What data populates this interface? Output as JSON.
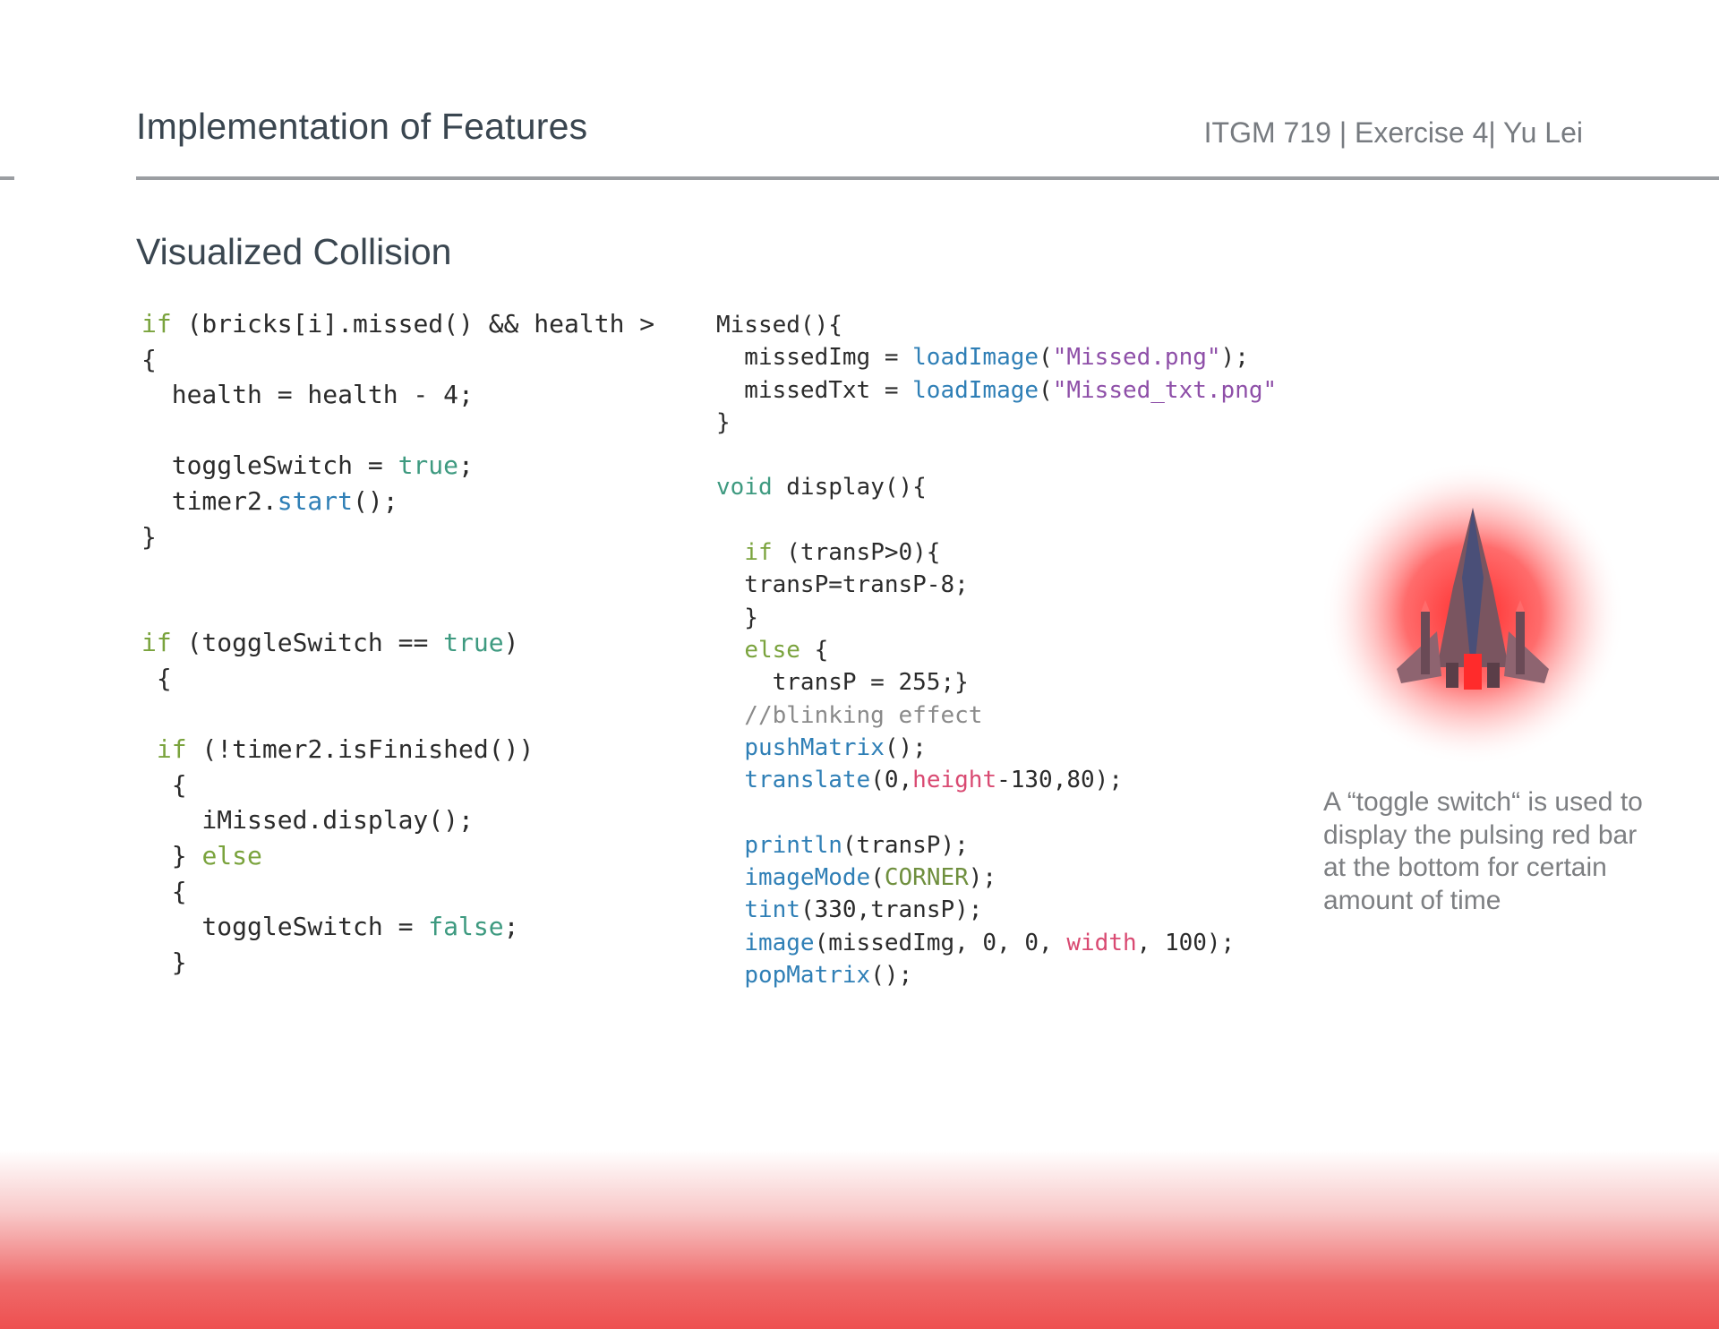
{
  "header": {
    "title": "Implementation of Features",
    "meta": "ITGM 719 | Exercise 4| Yu Lei"
  },
  "section": {
    "title": "Visualized Collision"
  },
  "left_code": [
    [
      {
        "t": "if",
        "c": "kw-green"
      },
      {
        "t": " (bricks[i].missed() && health > "
      }
    ],
    [
      {
        "t": "{"
      }
    ],
    [
      {
        "t": "  health = health - 4;"
      }
    ],
    [
      {
        "t": ""
      }
    ],
    [
      {
        "t": "  toggleSwitch = "
      },
      {
        "t": "true",
        "c": "kw-teal"
      },
      {
        "t": ";"
      }
    ],
    [
      {
        "t": "  timer2."
      },
      {
        "t": "start",
        "c": "fn-blue"
      },
      {
        "t": "();"
      }
    ],
    [
      {
        "t": "}"
      }
    ],
    [
      {
        "t": ""
      }
    ],
    [
      {
        "t": ""
      }
    ],
    [
      {
        "t": "if",
        "c": "kw-green"
      },
      {
        "t": " (toggleSwitch == "
      },
      {
        "t": "true",
        "c": "kw-teal"
      },
      {
        "t": ")"
      }
    ],
    [
      {
        "t": " {"
      }
    ],
    [
      {
        "t": ""
      }
    ],
    [
      {
        "t": " "
      },
      {
        "t": "if",
        "c": "kw-green"
      },
      {
        "t": " (!timer2.isFinished())"
      }
    ],
    [
      {
        "t": "  {"
      }
    ],
    [
      {
        "t": "    iMissed.display();"
      }
    ],
    [
      {
        "t": "  } "
      },
      {
        "t": "else",
        "c": "kw-green"
      }
    ],
    [
      {
        "t": "  {"
      }
    ],
    [
      {
        "t": "    toggleSwitch = "
      },
      {
        "t": "false",
        "c": "kw-teal"
      },
      {
        "t": ";"
      }
    ],
    [
      {
        "t": "  }"
      }
    ]
  ],
  "right_code": [
    [
      {
        "t": "Missed(){"
      }
    ],
    [
      {
        "t": "  missedImg = "
      },
      {
        "t": "loadImage",
        "c": "fn-blue"
      },
      {
        "t": "("
      },
      {
        "t": "\"Missed.png\"",
        "c": "str-purple"
      },
      {
        "t": ");"
      }
    ],
    [
      {
        "t": "  missedTxt = "
      },
      {
        "t": "loadImage",
        "c": "fn-blue"
      },
      {
        "t": "("
      },
      {
        "t": "\"Missed_txt.png\"",
        "c": "str-purple"
      }
    ],
    [
      {
        "t": "}"
      }
    ],
    [
      {
        "t": ""
      }
    ],
    [
      {
        "t": "void",
        "c": "kw-teal"
      },
      {
        "t": " display(){"
      }
    ],
    [
      {
        "t": ""
      }
    ],
    [
      {
        "t": "  "
      },
      {
        "t": "if",
        "c": "kw-green"
      },
      {
        "t": " (transP>0){"
      }
    ],
    [
      {
        "t": "  transP=transP-8;"
      }
    ],
    [
      {
        "t": "  }"
      }
    ],
    [
      {
        "t": "  "
      },
      {
        "t": "else",
        "c": "kw-green"
      },
      {
        "t": " {"
      }
    ],
    [
      {
        "t": "    transP = 255;}"
      }
    ],
    [
      {
        "t": "  //blinking effect",
        "c": "comment"
      }
    ],
    [
      {
        "t": "  "
      },
      {
        "t": "pushMatrix",
        "c": "fn-blue"
      },
      {
        "t": "();"
      }
    ],
    [
      {
        "t": "  "
      },
      {
        "t": "translate",
        "c": "fn-blue"
      },
      {
        "t": "(0,"
      },
      {
        "t": "height",
        "c": "var-pink"
      },
      {
        "t": "-130,80);"
      }
    ],
    [
      {
        "t": ""
      }
    ],
    [
      {
        "t": "  "
      },
      {
        "t": "println",
        "c": "fn-blue"
      },
      {
        "t": "(transP);"
      }
    ],
    [
      {
        "t": "  "
      },
      {
        "t": "imageMode",
        "c": "fn-blue"
      },
      {
        "t": "("
      },
      {
        "t": "CORNER",
        "c": "const-olive"
      },
      {
        "t": ");"
      }
    ],
    [
      {
        "t": "  "
      },
      {
        "t": "tint",
        "c": "fn-blue"
      },
      {
        "t": "(330,transP);"
      }
    ],
    [
      {
        "t": "  "
      },
      {
        "t": "image",
        "c": "fn-blue"
      },
      {
        "t": "(missedImg, 0, 0, "
      },
      {
        "t": "width",
        "c": "var-pink"
      },
      {
        "t": ", 100);"
      }
    ],
    [
      {
        "t": "  "
      },
      {
        "t": "popMatrix",
        "c": "fn-blue"
      },
      {
        "t": "();"
      }
    ]
  ],
  "caption": "A “toggle switch“ is used to display the pulsing red bar at the bottom for certain amount of time",
  "colors": {
    "title_text": "#3a4650",
    "meta_text": "#777b80",
    "rule": "#9b9ea2",
    "accent_red": "#ee5050",
    "ship_body": "#7a5560",
    "glow": "#ff2a2a"
  },
  "icons": {
    "ship": "spaceship-icon"
  }
}
